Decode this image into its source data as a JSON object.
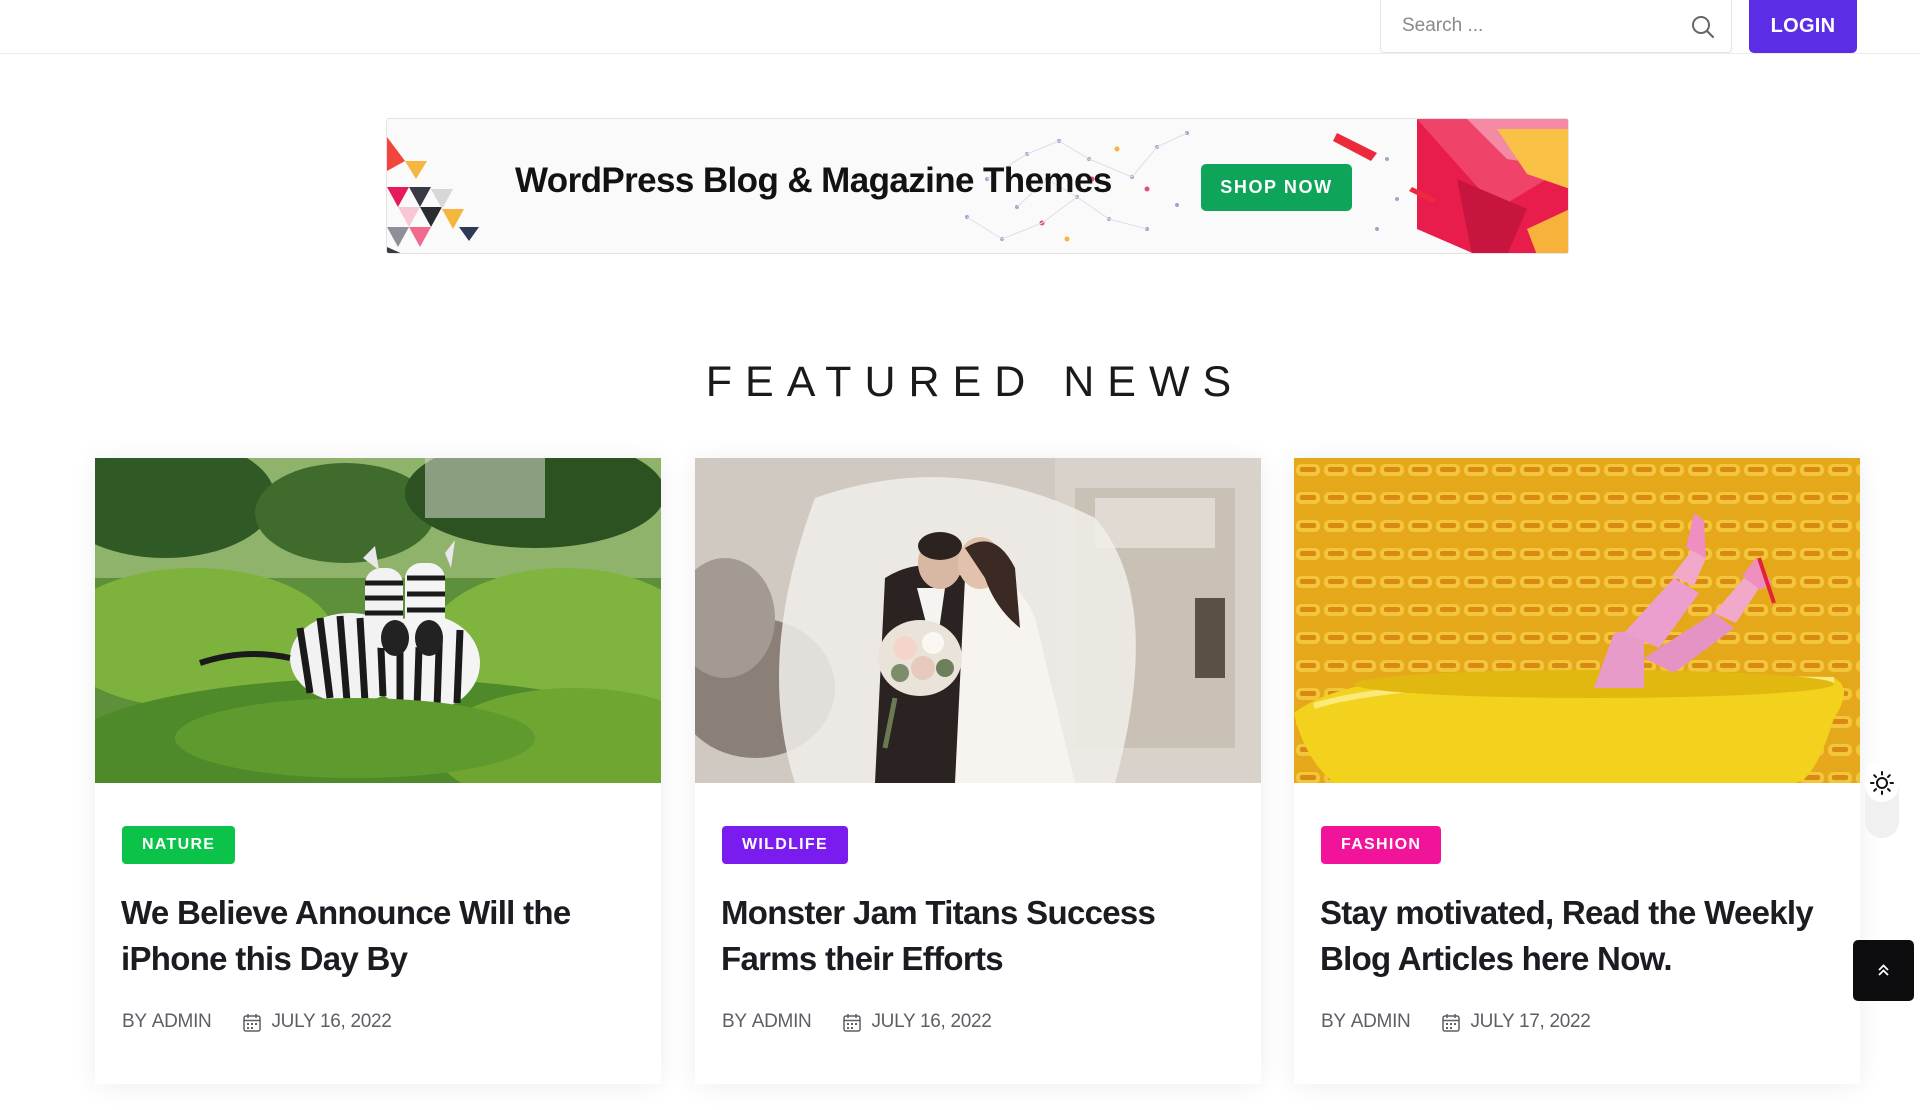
{
  "header": {
    "search": {
      "placeholder": "Search ...",
      "value": ""
    },
    "login_label": "LOGIN"
  },
  "banner": {
    "headline": "WordPress Blog & Magazine Themes",
    "cta_label": "SHOP NOW"
  },
  "featured": {
    "title": "FEATURED NEWS",
    "cards": [
      {
        "category": "NATURE",
        "category_color": "#0cc34a",
        "title": "We Believe Announce Will the iPhone this Day By",
        "by_prefix": "BY",
        "author": "ADMIN",
        "date": "JULY 16, 2022",
        "image": "zebras-in-grassland"
      },
      {
        "category": "WILDLIFE",
        "category_color": "#7a1cf0",
        "title": "Monster Jam Titans Success Farms their Efforts",
        "by_prefix": "BY",
        "author": "ADMIN",
        "date": "JULY 16, 2022",
        "image": "wedding-couple-veil"
      },
      {
        "category": "FASHION",
        "category_color": "#f2139b",
        "title": "Stay motivated, Read the Weekly Blog Articles here Now.",
        "by_prefix": "BY",
        "author": "ADMIN",
        "date": "JULY 17, 2022",
        "image": "pink-legs-yellow-bathtub"
      }
    ]
  },
  "widgets": {
    "theme_toggle_icon": "sun-icon",
    "scroll_top_icon": "double-chevron-up-icon"
  }
}
